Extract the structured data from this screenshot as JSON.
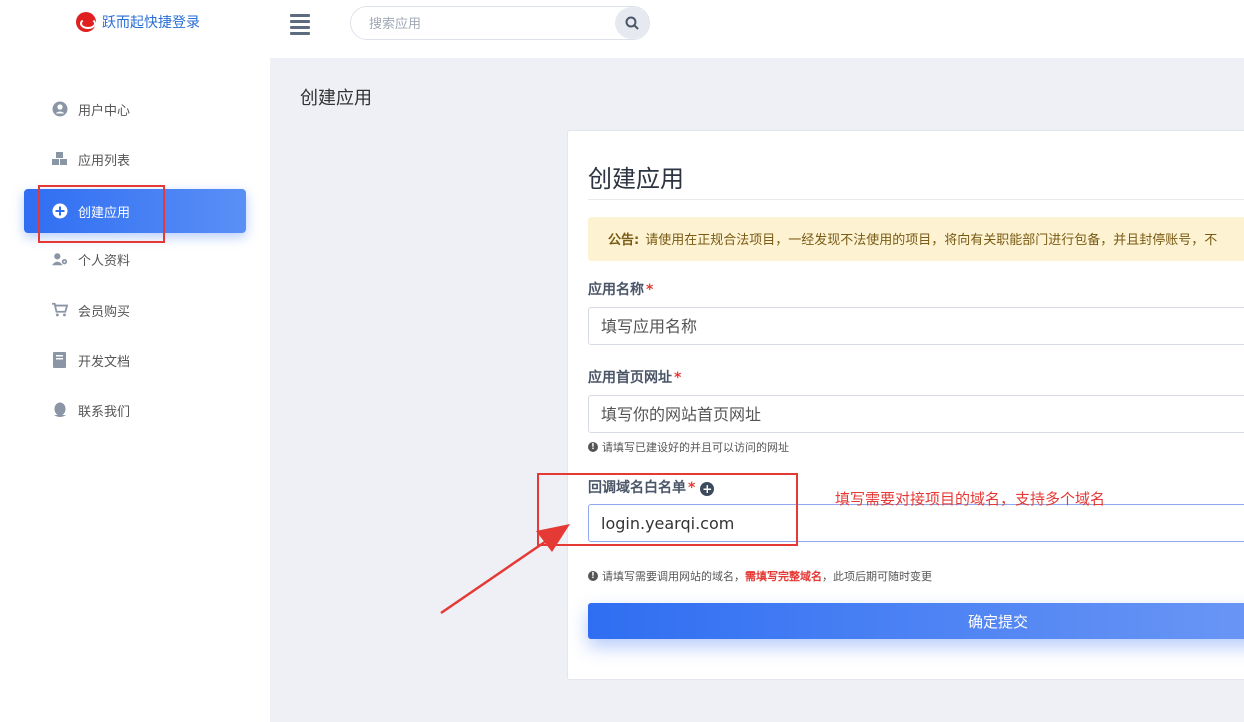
{
  "header": {
    "logo_text": "跃而起快捷登录",
    "search_placeholder": "搜索应用"
  },
  "sidebar": {
    "items": [
      {
        "label": "用户中心",
        "icon": "user-circle-icon"
      },
      {
        "label": "应用列表",
        "icon": "cubes-icon"
      },
      {
        "label": "创建应用",
        "icon": "plus-circle-icon",
        "active": true
      },
      {
        "label": "个人资料",
        "icon": "user-cog-icon"
      },
      {
        "label": "会员购买",
        "icon": "cart-icon"
      },
      {
        "label": "开发文档",
        "icon": "book-icon"
      },
      {
        "label": "联系我们",
        "icon": "qq-icon"
      }
    ]
  },
  "main": {
    "page_title": "创建应用",
    "card_title": "创建应用",
    "notice_label": "公告:",
    "notice_text": "请使用在正规合法项目，一经发现不法使用的项目，将向有关职能部门进行包备，并且封停账号，不",
    "fields": {
      "app_name": {
        "label": "应用名称",
        "required": "*",
        "placeholder": "填写应用名称"
      },
      "homepage": {
        "label": "应用首页网址",
        "required": "*",
        "placeholder": "填写你的网站首页网址",
        "help": "请填写已建设好的并且可以访问的网址"
      },
      "whitelist": {
        "label": "回调域名白名单",
        "required": "*",
        "value": "login.yearqi.com",
        "help_prefix": "请填写需要调用网站的域名，",
        "help_warn": "需填写完整域名",
        "help_suffix": "，此项后期可随时变更"
      }
    },
    "submit_label": "确定提交"
  },
  "annotation": {
    "text": "填写需要对接项目的域名，支持多个域名",
    "color": "#e53935"
  },
  "colors": {
    "accent": "#2f6ef2",
    "notice_bg": "#fdf3d2",
    "main_bg": "#eef0f5"
  }
}
